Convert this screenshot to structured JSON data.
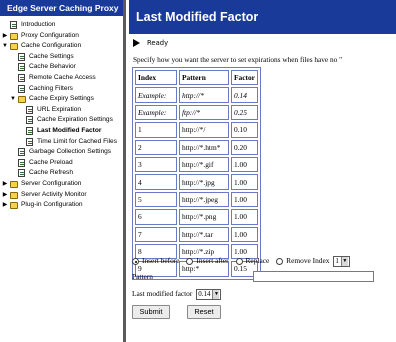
{
  "nav": {
    "header": "Edge Server Caching Proxy",
    "items": [
      {
        "label": "Introduction",
        "icon": "page-icon",
        "depth": 0,
        "arrow": ""
      },
      {
        "label": "Proxy Configuration",
        "icon": "folder-icon",
        "depth": 0,
        "arrow": "▶"
      },
      {
        "label": "Cache Configuration",
        "icon": "folder-icon",
        "depth": 0,
        "arrow": "▼"
      },
      {
        "label": "Cache Settings",
        "icon": "page-icon",
        "depth": 1,
        "arrow": ""
      },
      {
        "label": "Cache Behavior",
        "icon": "page-icon",
        "depth": 1,
        "arrow": ""
      },
      {
        "label": "Remote Cache Access",
        "icon": "page-icon",
        "depth": 1,
        "arrow": ""
      },
      {
        "label": "Caching Filters",
        "icon": "page-icon",
        "depth": 1,
        "arrow": ""
      },
      {
        "label": "Cache Expiry Settings",
        "icon": "folder-icon",
        "depth": 1,
        "arrow": "▼"
      },
      {
        "label": "URL Expiration",
        "icon": "page-icon",
        "depth": 2,
        "arrow": ""
      },
      {
        "label": "Cache Expiration Settings",
        "icon": "page-icon",
        "depth": 2,
        "arrow": ""
      },
      {
        "label": "Last Modified Factor",
        "icon": "page-icon",
        "depth": 2,
        "arrow": "",
        "current": true
      },
      {
        "label": "Time Limit for Cached Files",
        "icon": "page-icon",
        "depth": 2,
        "arrow": ""
      },
      {
        "label": "Garbage Collection Settings",
        "icon": "page-icon",
        "depth": 1,
        "arrow": ""
      },
      {
        "label": "Cache Preload",
        "icon": "page-icon",
        "depth": 1,
        "arrow": ""
      },
      {
        "label": "Cache Refresh",
        "icon": "page-icon",
        "depth": 1,
        "arrow": ""
      },
      {
        "label": "Server Configuration",
        "icon": "folder-icon",
        "depth": 0,
        "arrow": "▶"
      },
      {
        "label": "Server Activity Monitor",
        "icon": "folder-icon",
        "depth": 0,
        "arrow": "▶"
      },
      {
        "label": "Plug-in Configuration",
        "icon": "folder-icon",
        "depth": 0,
        "arrow": "▶"
      }
    ]
  },
  "main": {
    "title": "Last Modified Factor",
    "status": "Ready",
    "instruction": "Specify how you want the server to set expirations when files have no \"",
    "table": {
      "headers": [
        "Index",
        "Pattern",
        "Factor"
      ],
      "rows": [
        {
          "index": "Example:",
          "pattern": "http://*",
          "factor": "0.14",
          "example": true
        },
        {
          "index": "Example:",
          "pattern": "ftp://*",
          "factor": "0.25",
          "example": true
        },
        {
          "index": "1",
          "pattern": "http://*/",
          "factor": "0.10"
        },
        {
          "index": "2",
          "pattern": "http://*.htm*",
          "factor": "0.20"
        },
        {
          "index": "3",
          "pattern": "http://*.gif",
          "factor": "1.00"
        },
        {
          "index": "4",
          "pattern": "http://*.jpg",
          "factor": "1.00"
        },
        {
          "index": "5",
          "pattern": "http://*.jpeg",
          "factor": "1.00"
        },
        {
          "index": "6",
          "pattern": "http://*.png",
          "factor": "1.00"
        },
        {
          "index": "7",
          "pattern": "http://*.tar",
          "factor": "1.00"
        },
        {
          "index": "8",
          "pattern": "http://*.zip",
          "factor": "1.00"
        },
        {
          "index": "9",
          "pattern": "http:*",
          "factor": "0.15"
        }
      ]
    },
    "actions": {
      "insert_before": "Insert before",
      "insert_after": "Insert after",
      "replace": "Replace",
      "remove_index": "Remove Index",
      "index_value": "1",
      "selected": "insert_before"
    },
    "pattern_label": "Pattern",
    "pattern_value": "",
    "factor_label": "Last modified factor",
    "factor_value": "0.14",
    "submit_label": "Submit",
    "reset_label": "Reset"
  }
}
